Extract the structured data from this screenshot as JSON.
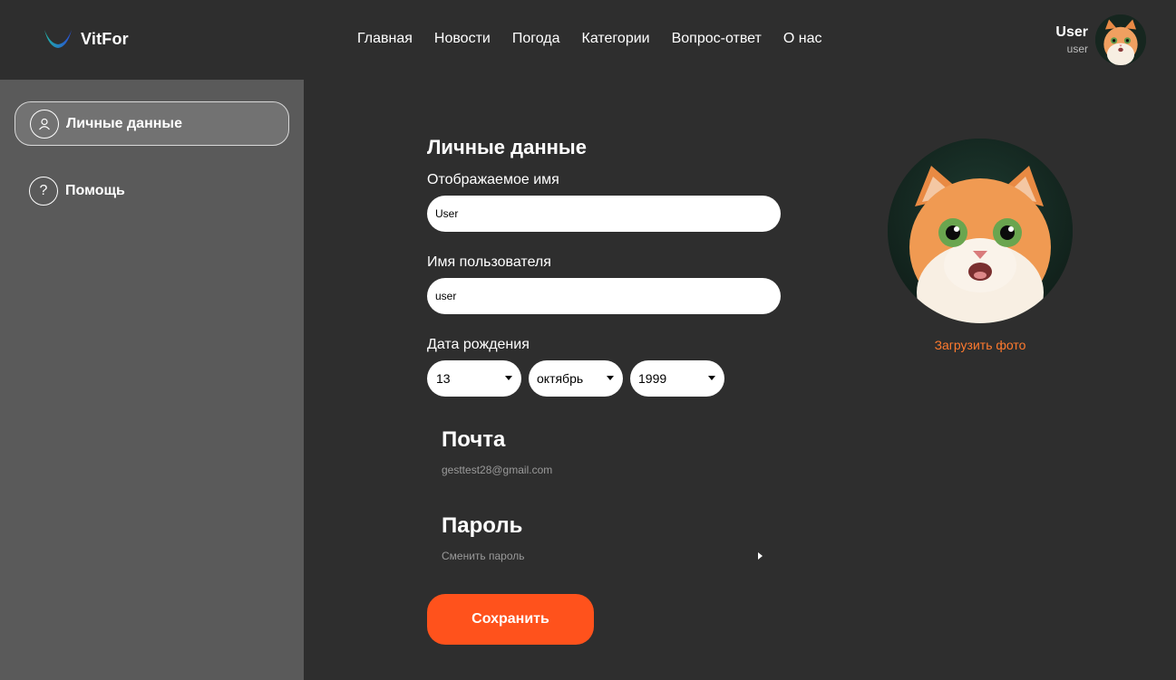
{
  "brand": {
    "name": "VitFor"
  },
  "nav": [
    {
      "label": "Главная"
    },
    {
      "label": "Новости"
    },
    {
      "label": "Погода"
    },
    {
      "label": "Категории"
    },
    {
      "label": "Вопрос-ответ"
    },
    {
      "label": "О нас"
    }
  ],
  "user": {
    "display_name": "User",
    "username": "user"
  },
  "sidebar": {
    "items": [
      {
        "label": "Личные данные",
        "icon": "user-icon",
        "active": true
      },
      {
        "label": "Помощь",
        "icon": "question-icon",
        "active": false
      }
    ]
  },
  "form": {
    "title": "Личные данные",
    "display_name_label": "Отображаемое имя",
    "display_name_value": "User",
    "username_label": "Имя пользователя",
    "username_value": "user",
    "birthdate_label": "Дата рождения",
    "birth_day": "13",
    "birth_month": "октябрь",
    "birth_year": "1999",
    "email_title": "Почта",
    "email_value": "gesttest28@gmail.com",
    "password_title": "Пароль",
    "password_action": "Сменить пароль",
    "save_label": "Сохранить"
  },
  "photo": {
    "upload_label": "Загрузить фото"
  },
  "colors": {
    "accent": "#ff521c",
    "link": "#ff7a2e",
    "sidebar": "#5a5a5a",
    "background": "#2e2e2e"
  }
}
